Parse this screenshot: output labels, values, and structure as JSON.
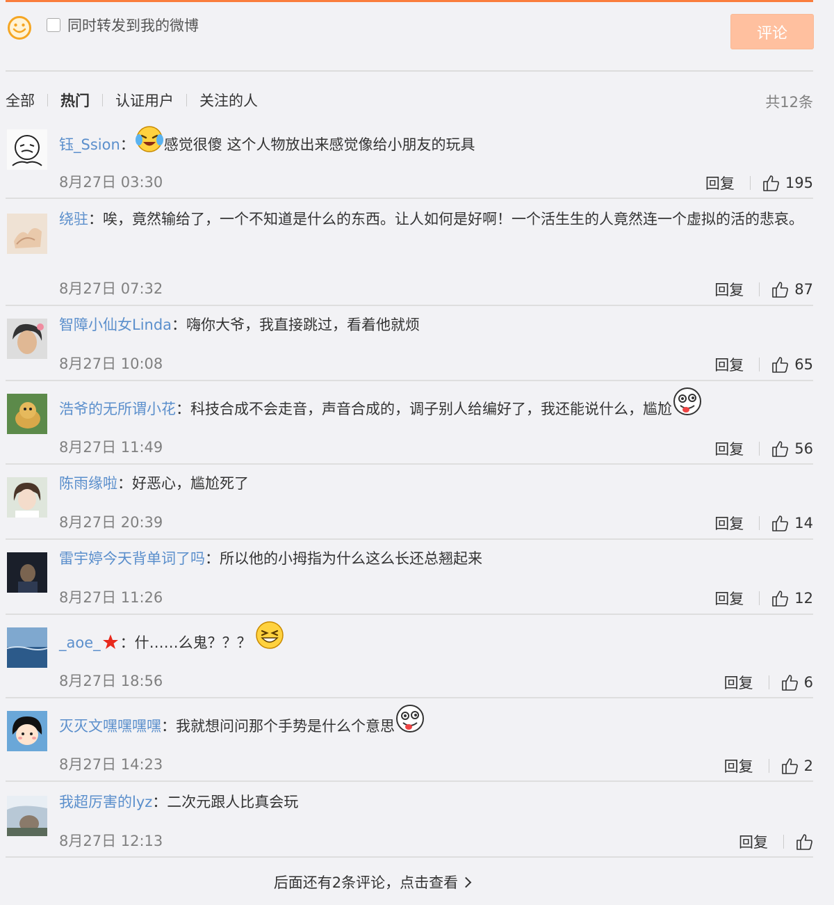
{
  "composer": {
    "forward_label": "同时转发到我的微博",
    "submit_label": "评论",
    "emoji_icon": "smile-face-icon"
  },
  "filters": {
    "tabs": [
      "全部",
      "热门",
      "认证用户",
      "关注的人"
    ],
    "active_tab": "热门",
    "total": "共12条"
  },
  "colors": {
    "accent": "#fa7d3c",
    "submit_bg": "#ffc09f",
    "username": "#5b8fcc",
    "muted": "#808080"
  },
  "comments": [
    {
      "user": "钰_Ssion",
      "sep": "：",
      "text": "感觉很傻 这个人物放出来感觉像给小朋友的玩具",
      "emoji_before": "laughing-tears-emoji",
      "date": "8月27日 03:30",
      "reply": "回复",
      "likes": "195"
    },
    {
      "user": "绕驻",
      "sep": "：",
      "text": "唉，竟然输给了，一个不知道是什么的东西。让人如何是好啊！一个活生生的人竟然连一个虚拟的活的悲哀。",
      "date": "8月27日 07:32",
      "reply": "回复",
      "likes": "87"
    },
    {
      "user": "智障小仙女Linda",
      "sep": "：",
      "text": "嗨你大爷，我直接跳过，看着他就烦",
      "date": "8月27日 10:08",
      "reply": "回复",
      "likes": "65"
    },
    {
      "user": "浩爷的无所谓小花",
      "sep": "：",
      "text": "科技合成不会走音，声音合成的，调子别人给编好了，我还能说什么，尴尬",
      "emoji_after": "silly-face-emoji",
      "date": "8月27日 11:49",
      "reply": "回复",
      "likes": "56"
    },
    {
      "user": "陈雨缘啦",
      "sep": "：",
      "text": "好恶心，尴尬死了",
      "date": "8月27日 20:39",
      "reply": "回复",
      "likes": "14"
    },
    {
      "user": "雷宇婷今天背单词了吗",
      "sep": "：",
      "text": "所以他的小拇指为什么这么长还总翘起来",
      "date": "8月27日 11:26",
      "reply": "回复",
      "likes": "12"
    },
    {
      "user": "_aoe_",
      "sep": "：",
      "text": "什……么鬼？？？",
      "badge": "red-star-badge",
      "emoji_after": "squint-laugh-emoji",
      "date": "8月27日 18:56",
      "reply": "回复",
      "likes": "6"
    },
    {
      "user": "灭灭文嘿嘿嘿嘿",
      "sep": "：",
      "text": "我就想问问那个手势是什么个意思",
      "emoji_after": "silly-face-emoji",
      "date": "8月27日 14:23",
      "reply": "回复",
      "likes": "2"
    },
    {
      "user": "我超厉害的lyz",
      "sep": "：",
      "text": "二次元跟人比真会玩",
      "date": "8月27日 12:13",
      "reply": "回复",
      "likes": ""
    }
  ],
  "more": {
    "label": "后面还有2条评论，点击查看"
  }
}
